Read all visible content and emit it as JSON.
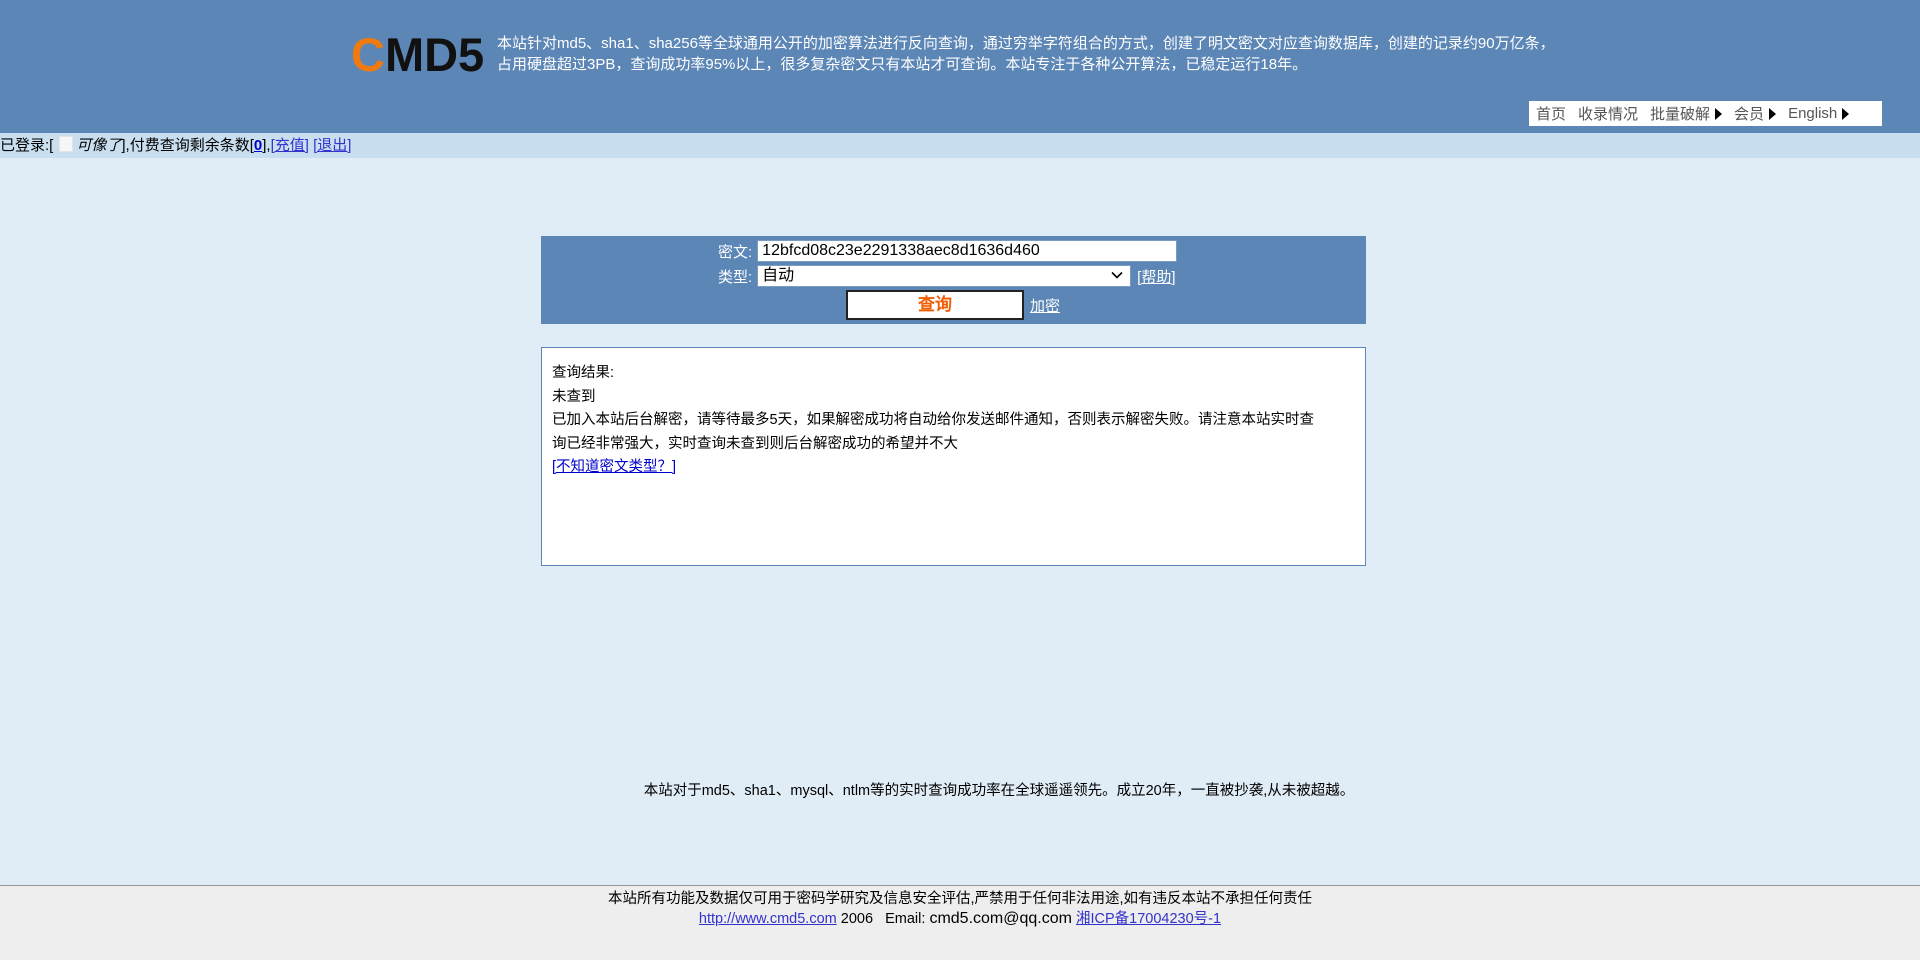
{
  "header": {
    "logo_first": "C",
    "logo_rest": "MD5",
    "intro_line1": "本站针对md5、sha1、sha256等全球通用公开的加密算法进行反向查询，通过穷举字符组合的方式，创建了明文密文对应查询数据库，创建的记录约90万亿条，",
    "intro_line2": "占用硬盘超过3PB，查询成功率95%以上，很多复杂密文只有本站才可查询。本站专注于各种公开算法，已稳定运行18年。",
    "logo_accent_color": "#f07a10",
    "background_color": "#5b86b5"
  },
  "nav": {
    "items": [
      {
        "label": "首页",
        "has_arrow": false
      },
      {
        "label": "收录情况",
        "has_arrow": false
      },
      {
        "label": "批量破解",
        "has_arrow": true
      },
      {
        "label": "会员",
        "has_arrow": true
      },
      {
        "label": "English",
        "has_arrow": true
      }
    ]
  },
  "login": {
    "prefix": "已登录:[",
    "username": "可像了",
    "after_user": "],付费查询剩余条数[",
    "remaining": "0",
    "after_count": "],",
    "recharge": "[充值]",
    "logout": "[退出]"
  },
  "query": {
    "cipher_label": "密文:",
    "cipher_value": "12bfcd08c23e2291338aec8d1636d460",
    "type_label": "类型:",
    "type_selected": "自动",
    "help_link": "[帮助]",
    "submit_label": "查询",
    "encrypt_link": "加密"
  },
  "result": {
    "title": "查询结果:",
    "status": "未查到",
    "message_line1": "已加入本站后台解密，请等待最多5天，如果解密成功将自动给你发送邮件通知，否则表示解密失败。请注意本站实时查",
    "message_line2": "询已经非常强大，实时查询未查到则后台解密成功的希望并不大",
    "unknown_type_link": "[不知道密文类型？]"
  },
  "slogan": "本站对于md5、sha1、mysql、ntlm等的实时查询成功率在全球遥遥领先。成立20年，一直被抄袭,从未被超越。",
  "footer": {
    "disclaimer": "本站所有功能及数据仅可用于密码学研究及信息安全评估,严禁用于任何非法用途,如有违反本站不承担任何责任",
    "site_url": "http://www.cmd5.com",
    "year": "2006",
    "email_label": "Email:",
    "email": "cmd5.com@qq.com",
    "icp": "湘ICP备17004230号-1"
  }
}
